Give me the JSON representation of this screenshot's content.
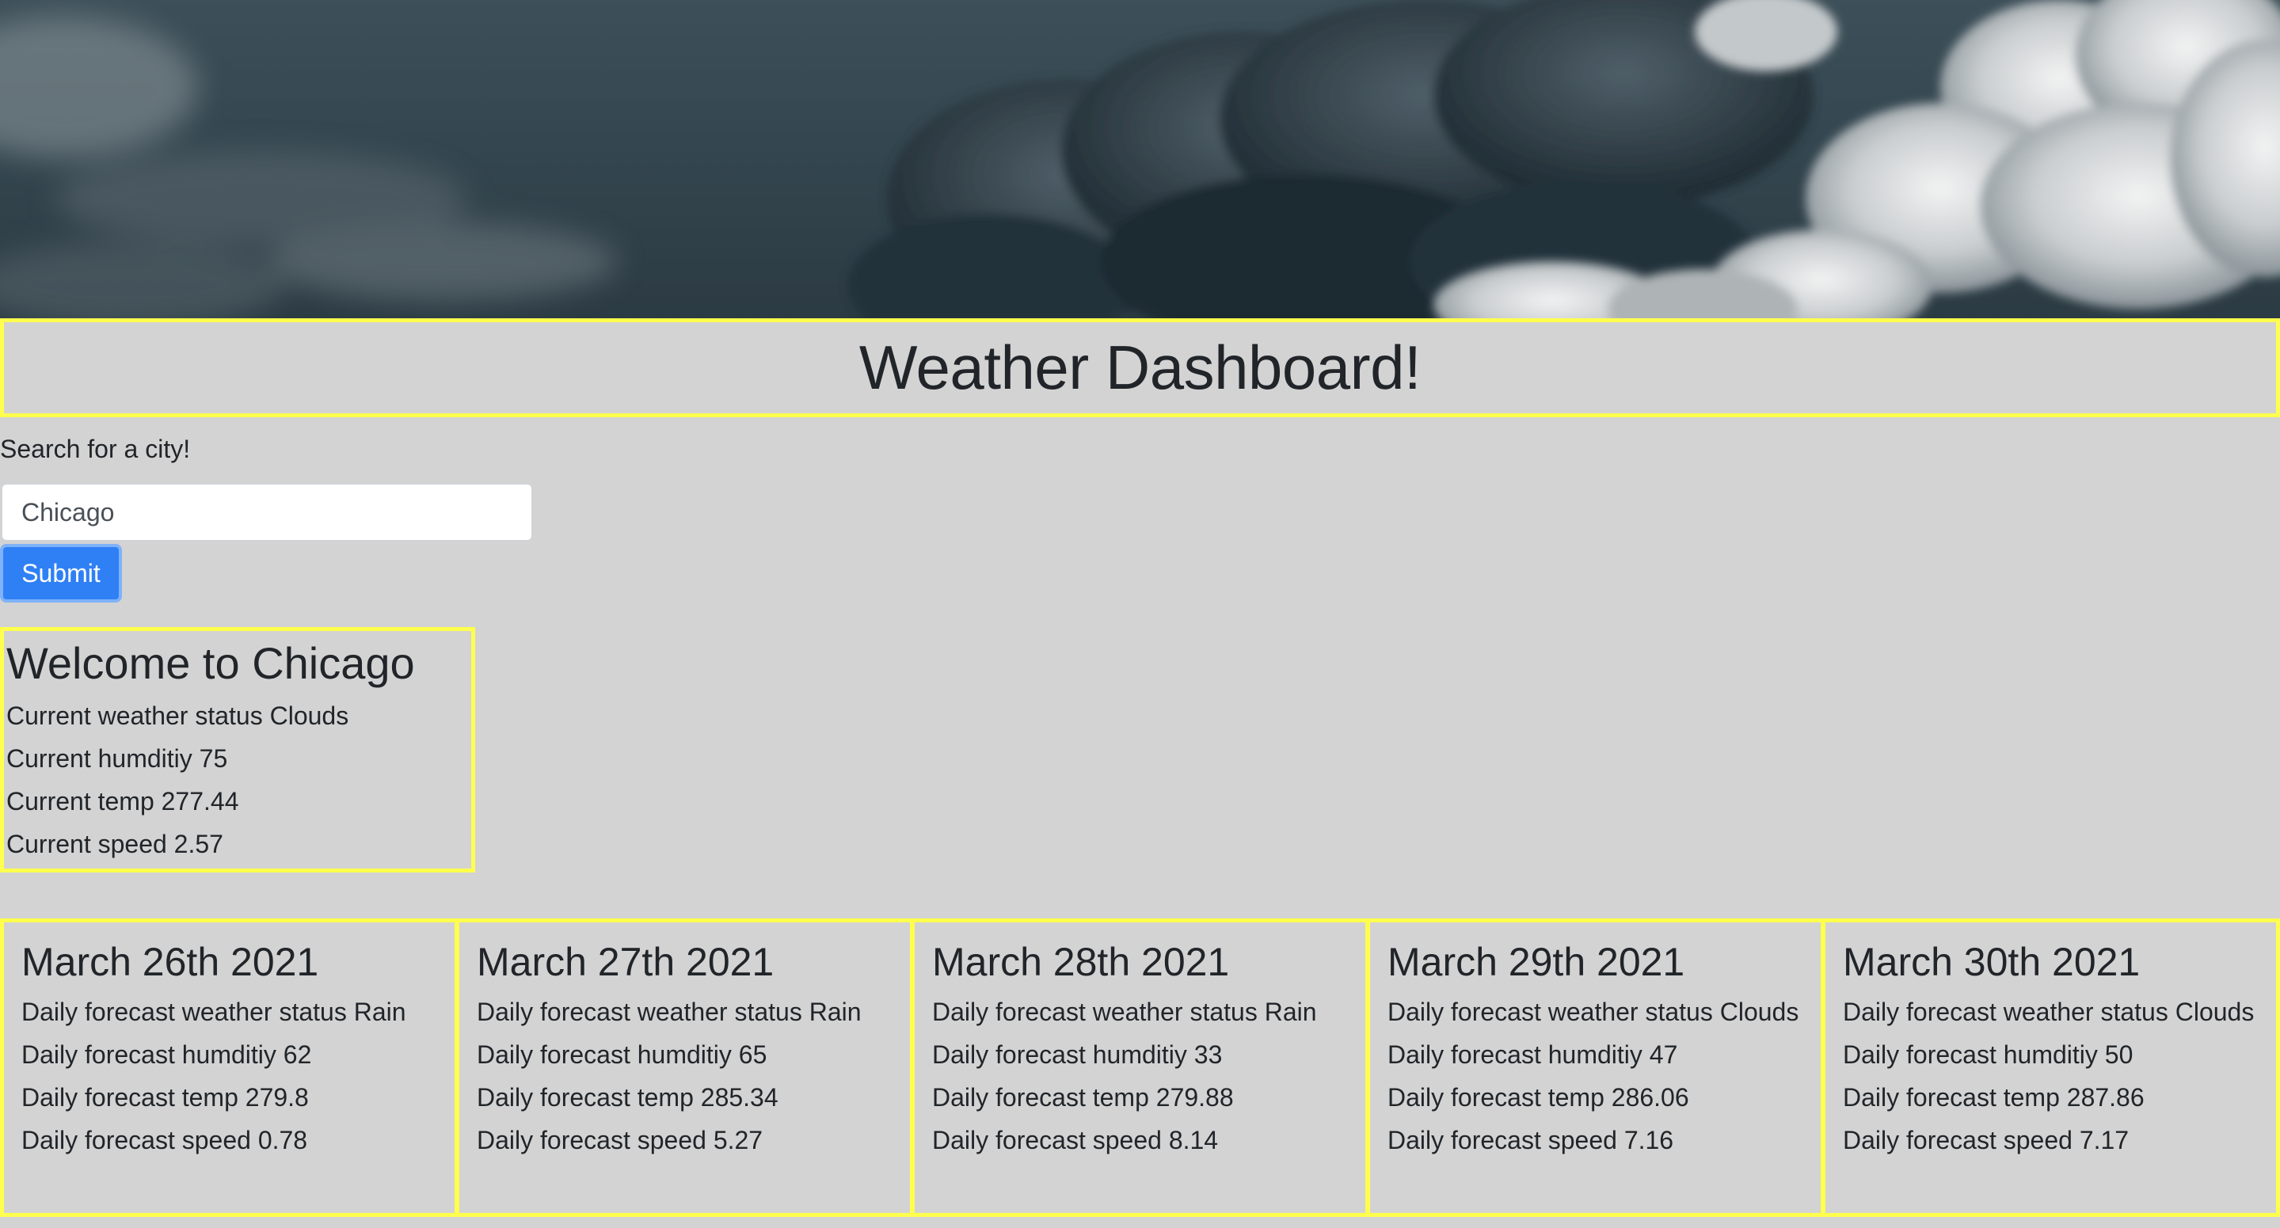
{
  "header": {
    "title": "Weather Dashboard!"
  },
  "search": {
    "label": "Search for a city!",
    "value": "Chicago",
    "submit_label": "Submit"
  },
  "current": {
    "title": "Welcome to Chicago",
    "status": "Current weather status Clouds",
    "humidity": "Current humditiy 75",
    "temp": "Current temp 277.44",
    "speed": "Current speed 2.57"
  },
  "forecast": [
    {
      "date": "March 26th 2021",
      "status": "Daily forecast weather status Rain",
      "humidity": "Daily forecast humditiy 62",
      "temp": "Daily forecast temp 279.8",
      "speed": "Daily forecast speed 0.78"
    },
    {
      "date": "March 27th 2021",
      "status": "Daily forecast weather status Rain",
      "humidity": "Daily forecast humditiy 65",
      "temp": "Daily forecast temp 285.34",
      "speed": "Daily forecast speed 5.27"
    },
    {
      "date": "March 28th 2021",
      "status": "Daily forecast weather status Rain",
      "humidity": "Daily forecast humditiy 33",
      "temp": "Daily forecast temp 279.88",
      "speed": "Daily forecast speed 8.14"
    },
    {
      "date": "March 29th 2021",
      "status": "Daily forecast weather status Clouds",
      "humidity": "Daily forecast humditiy 47",
      "temp": "Daily forecast temp 286.06",
      "speed": "Daily forecast speed 7.16"
    },
    {
      "date": "March 30th 2021",
      "status": "Daily forecast weather status Clouds",
      "humidity": "Daily forecast humditiy 50",
      "temp": "Daily forecast temp 287.86",
      "speed": "Daily forecast speed 7.17"
    }
  ],
  "colors": {
    "page_background": "#d3d3d3",
    "border_highlight": "#ffff4d",
    "button_primary": "#2f80f5",
    "text": "#212529"
  }
}
